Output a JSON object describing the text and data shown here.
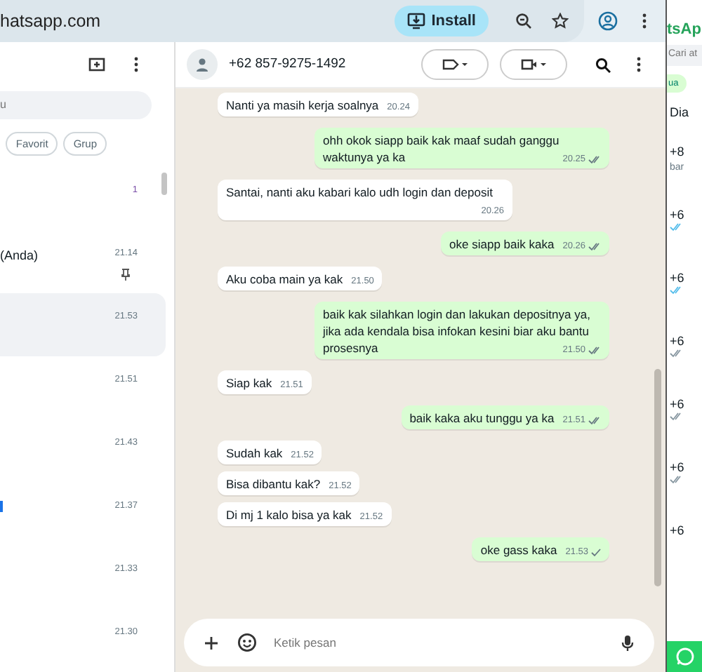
{
  "browser": {
    "url": "hatsapp.com",
    "install_label": "Install"
  },
  "sidebar": {
    "search_placeholder": "u",
    "filters": [
      {
        "label": "Favorit",
        "selected": false
      },
      {
        "label": "Grup",
        "selected": false
      }
    ],
    "chats": [
      {
        "badge": "1",
        "pinned": false,
        "selected": false,
        "mark": false
      },
      {
        "title": "(Anda)",
        "time": "21.14",
        "pinned": true,
        "selected": false,
        "mark": false
      },
      {
        "time": "21.53",
        "pinned": false,
        "selected": true,
        "mark": false
      },
      {
        "time": "21.51",
        "pinned": false,
        "selected": false,
        "mark": false
      },
      {
        "time": "21.43",
        "pinned": false,
        "selected": false,
        "mark": false
      },
      {
        "time": "21.37",
        "pinned": false,
        "selected": false,
        "mark": true
      },
      {
        "time": "21.33",
        "pinned": false,
        "selected": false,
        "mark": false
      },
      {
        "time": "21.30",
        "pinned": false,
        "selected": false,
        "mark": false
      }
    ]
  },
  "chat": {
    "contact": "+62 857-9275-1492",
    "messages": [
      {
        "kind": "in",
        "text": "Nanti ya masih kerja soalnya",
        "time": "20.24"
      },
      {
        "kind": "out",
        "text": "ohh okok siapp baik kak maaf sudah ganggu waktunya ya ka",
        "time": "20.25",
        "delivered": true
      },
      {
        "kind": "in",
        "text": "Santai, nanti aku kabari kalo udh login dan deposit",
        "time": "20.26"
      },
      {
        "kind": "out",
        "text": "oke siapp baik kaka",
        "time": "20.26",
        "delivered": true
      },
      {
        "kind": "in",
        "text": "Aku coba main ya kak",
        "time": "21.50"
      },
      {
        "kind": "out",
        "text": "baik kak silahkan login dan lakukan depositnya ya, jika ada kendala bisa infokan kesini biar aku bantu prosesnya",
        "time": "21.50",
        "delivered": true
      },
      {
        "kind": "in",
        "text": "Siap kak",
        "time": "21.51"
      },
      {
        "kind": "out",
        "text": "baik kaka aku tunggu ya ka",
        "time": "21.51",
        "delivered": true
      },
      {
        "kind": "in",
        "text": "Sudah kak",
        "time": "21.52"
      },
      {
        "kind": "in",
        "text": "Bisa dibantu kak?",
        "time": "21.52"
      },
      {
        "kind": "in",
        "text": "Di mj 1 kalo bisa ya kak",
        "time": "21.52"
      },
      {
        "kind": "out",
        "text": "oke gass kaka",
        "time": "21.53",
        "delivered": false
      }
    ],
    "input_placeholder": "Ketik pesan"
  },
  "second_window": {
    "title": "tsAp",
    "search_placeholder": "Cari at",
    "chip": "ua",
    "heading": "Dia",
    "chats": [
      {
        "kind": "plain",
        "name": "+8",
        "preview": "bar"
      },
      {
        "kind": "read",
        "name": "+6"
      },
      {
        "kind": "read",
        "name": "+6"
      },
      {
        "kind": "delivered",
        "name": "+6"
      },
      {
        "kind": "delivered",
        "name": "+6"
      },
      {
        "kind": "delivered",
        "name": "+6"
      },
      {
        "kind": "plain",
        "name": "+6"
      }
    ]
  }
}
